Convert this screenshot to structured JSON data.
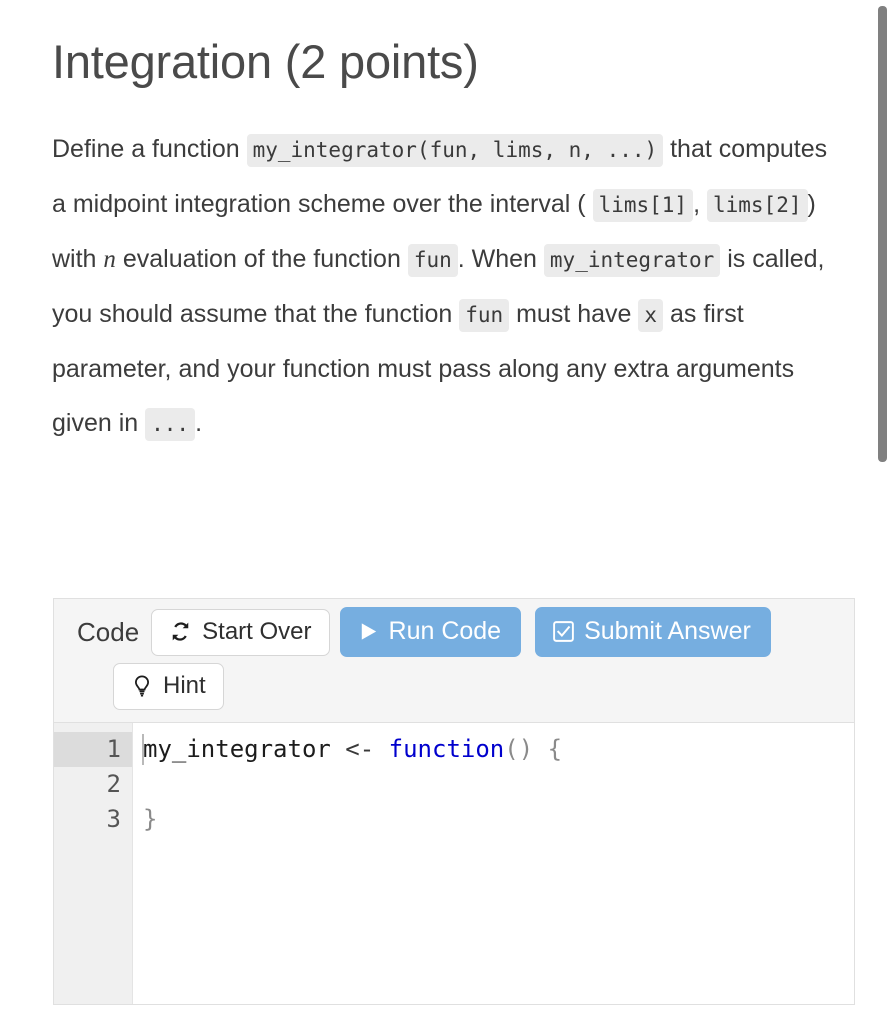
{
  "page": {
    "title": "Integration (2 points)"
  },
  "prose": {
    "s1": "Define a function",
    "code1": "my_integrator(fun, lims, n, ...)",
    "s2": "that computes a midpoint integration scheme over the interval (",
    "code2": "lims[1]",
    "s3": ",",
    "code3": "lims[2]",
    "s4": ") with",
    "mathvar": "n",
    "s5": "evaluation of the function",
    "code4": "fun",
    "s6": ". When",
    "code5": "my_integrator",
    "s7": "is called, you should assume that the function",
    "code6": "fun",
    "s8": "must have",
    "code7": "x",
    "s9": "as first parameter, and your function must pass along any extra arguments given in",
    "code8": "...",
    "s10": "."
  },
  "exercise": {
    "label": "Code",
    "buttons": {
      "start_over": "Start Over",
      "hint": "Hint",
      "run_code": "Run Code",
      "submit_answer": "Submit Answer"
    },
    "icons": {
      "start_over": "refresh-icon",
      "hint": "lightbulb-icon",
      "run_code": "play-icon",
      "submit_answer": "checkbox-checked-icon"
    },
    "colors": {
      "primary_button": "#76aee0",
      "header_background": "#f5f5f5",
      "gutter_background": "#f0f0f0",
      "active_line": "#dcdcdc",
      "keyword": "#0000cd"
    }
  },
  "editor": {
    "line_numbers": [
      "1",
      "2",
      "3"
    ],
    "active_line": 1,
    "lines": [
      {
        "number": "1",
        "tokens": [
          {
            "text": "my_integrator ",
            "type": "plain"
          },
          {
            "text": "<-",
            "type": "op"
          },
          {
            "text": " ",
            "type": "plain"
          },
          {
            "text": "function",
            "type": "kw"
          },
          {
            "text": "()",
            "type": "punct"
          },
          {
            "text": " ",
            "type": "plain"
          },
          {
            "text": "{",
            "type": "punct"
          }
        ]
      },
      {
        "number": "2",
        "tokens": []
      },
      {
        "number": "3",
        "tokens": [
          {
            "text": "}",
            "type": "punct"
          }
        ]
      }
    ]
  },
  "scrollbar": {
    "orientation": "vertical",
    "position": "right"
  }
}
